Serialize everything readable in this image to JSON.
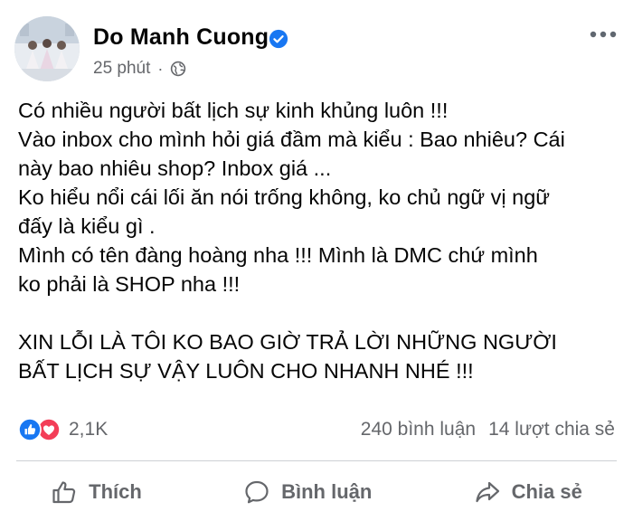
{
  "post": {
    "author": "Do Manh Cuong",
    "time": "25 phút",
    "separator": "·",
    "text_lines": [
      "Có nhiều người bất lịch sự kinh khủng luôn !!!",
      "Vào inbox cho mình hỏi giá đầm mà kiểu : Bao nhiêu? Cái",
      "này bao nhiêu shop? Inbox giá ...",
      "Ko hiểu nổi cái lối ăn nói trống không, ko chủ ngữ vị ngữ",
      "đấy là kiểu gì .",
      "Mình có tên đàng hoàng nha !!! Mình là DMC chứ mình",
      "ko phải là SHOP nha !!!",
      "XIN LỖI LÀ TÔI KO BAO GIỜ TRẢ LỜI NHỮNG NGƯỜI",
      "BẤT LỊCH SỰ VẬY LUÔN CHO NHANH NHÉ !!!"
    ],
    "reaction_count": "2,1K",
    "comment_count": "240 bình luận",
    "share_count": "14 lượt chia sẻ"
  },
  "actions": {
    "like": "Thích",
    "comment": "Bình luận",
    "share": "Chia sẻ"
  },
  "icons": {
    "verified": "verified-badge-icon",
    "audience": "globe-icon",
    "more": "more-options-icon",
    "reaction_like": "like-reaction-icon",
    "reaction_love": "love-reaction-icon"
  },
  "colors": {
    "verified_blue": "#1877f2",
    "like_blue": "#1877f2",
    "love_red": "#f33e58",
    "secondary_text": "#65676b"
  }
}
